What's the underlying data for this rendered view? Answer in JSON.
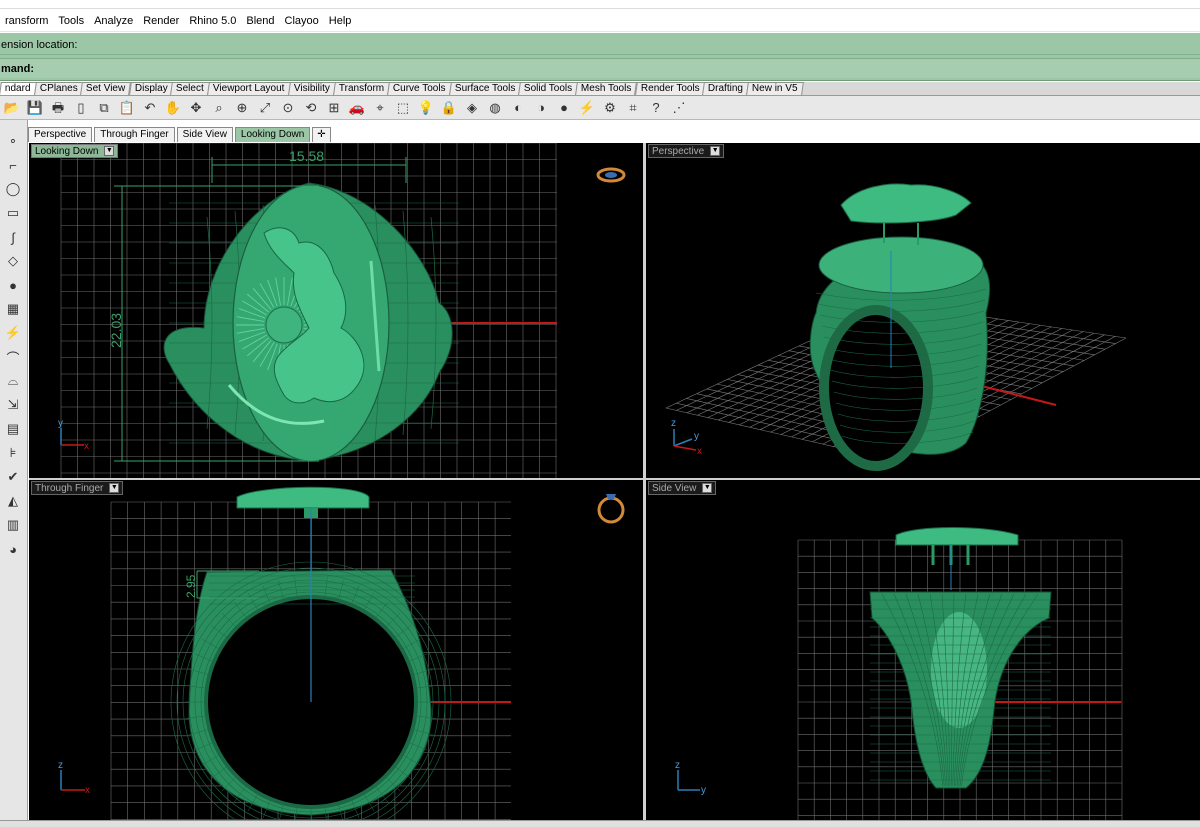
{
  "menu": [
    "ransform",
    "Tools",
    "Analyze",
    "Render",
    "Rhino 5.0",
    "Blend",
    "Clayoo",
    "Help"
  ],
  "command": {
    "line1": "ension location:",
    "line2": "mand:"
  },
  "toolbar_tabs": [
    "ndard",
    "CPlanes",
    "Set View",
    "Display",
    "Select",
    "Viewport Layout",
    "Visibility",
    "Transform",
    "Curve Tools",
    "Surface Tools",
    "Solid Tools",
    "Mesh Tools",
    "Render Tools",
    "Drafting",
    "New in V5"
  ],
  "toolbar_tabs_active": "ndard",
  "toolbar_icons": [
    "open-icon",
    "save-icon",
    "print-icon",
    "new-icon",
    "copy-icon",
    "paste-icon",
    "undo-icon",
    "pan-hand-icon",
    "move-view-icon",
    "zoom-icon",
    "zoom-window-icon",
    "zoom-extents-icon",
    "zoom-selected-icon",
    "rotate-view-icon",
    "four-viewports-icon",
    "car-icon",
    "snap-icon",
    "select-point-icon",
    "light-bulb-icon",
    "lock-icon",
    "layer-icon",
    "color-wheel-icon",
    "shaded-sphere-icon",
    "rendered-sphere-icon",
    "render-sphere-icon",
    "flash-icon",
    "gear-group-icon",
    "dimension-icon",
    "help-icon",
    "options-icon"
  ],
  "left_tool_icons": [
    "point-icon",
    "polyline-icon",
    "circle-icon",
    "rectangle-icon",
    "curve-icon",
    "surface-icon",
    "solid-sphere-icon",
    "mesh-icon",
    "flash-icon",
    "curve-tools-icon",
    "fillet-icon",
    "transform-icon",
    "array-icon",
    "analyze-icon",
    "check-icon",
    "layer-paint-icon",
    "stack-icon",
    "render-icon"
  ],
  "viewport_tabs": [
    "Perspective",
    "Through Finger",
    "Side View",
    "Looking Down"
  ],
  "viewport_tabs_active": "Looking Down",
  "viewports": {
    "looking_down": {
      "label": "Looking Down",
      "dim_horizontal": "15.58",
      "dim_vertical": "22.03",
      "axis_primary": "y",
      "axis_secondary": "x"
    },
    "perspective": {
      "label": "Perspective",
      "axis_z": "z",
      "axis_y": "y",
      "axis_x": "x"
    },
    "through_finger": {
      "label": "Through Finger",
      "dim_small": "2.95",
      "axis_primary": "z",
      "axis_secondary": "x"
    },
    "side_view": {
      "label": "Side View",
      "axis_primary": "z",
      "axis_secondary": "y"
    }
  },
  "colors": {
    "model_green": "#2e9a66",
    "model_dark": "#0f5a38",
    "grid": "#7a7a7a",
    "grid_major": "#a0a0a0",
    "axis_red": "#c41818",
    "axis_blue": "#2a7fb8",
    "command_bg": "#9cc7a6",
    "dimension_green": "#3ba06a"
  }
}
